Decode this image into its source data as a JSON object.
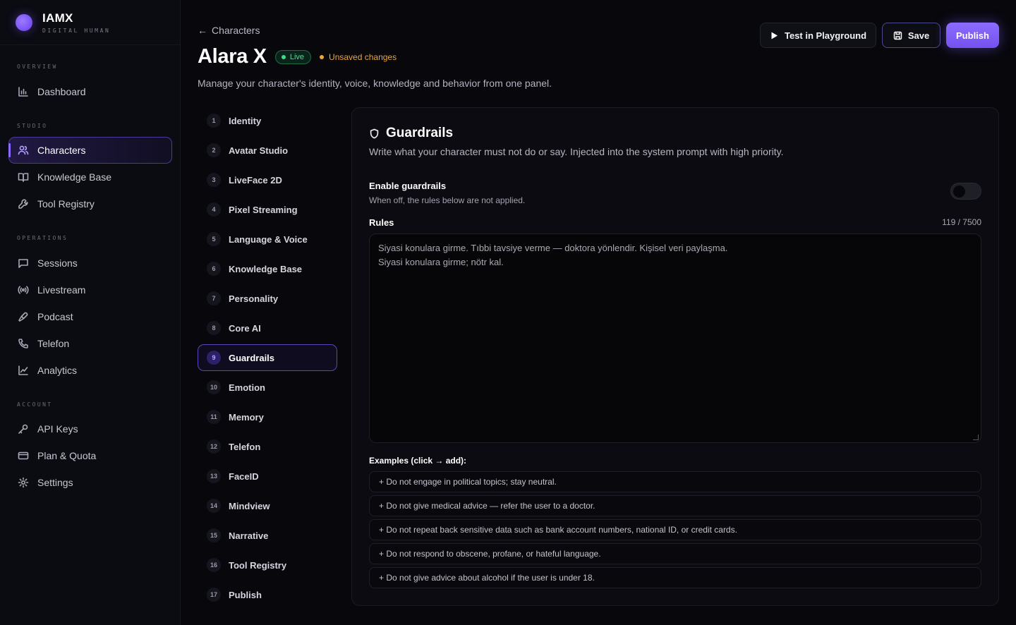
{
  "brand": {
    "title": "IAMX",
    "subtitle": "DIGITAL HUMAN"
  },
  "sidebar": {
    "sections": [
      {
        "title": "OVERVIEW",
        "items": [
          {
            "label": "Dashboard",
            "icon": "bar-chart-icon"
          }
        ]
      },
      {
        "title": "STUDIO",
        "items": [
          {
            "label": "Characters",
            "icon": "users-icon",
            "active": true
          },
          {
            "label": "Knowledge Base",
            "icon": "book-icon"
          },
          {
            "label": "Tool Registry",
            "icon": "wrench-icon"
          }
        ]
      },
      {
        "title": "OPERATIONS",
        "items": [
          {
            "label": "Sessions",
            "icon": "chat-icon"
          },
          {
            "label": "Livestream",
            "icon": "broadcast-icon"
          },
          {
            "label": "Podcast",
            "icon": "mic-icon"
          },
          {
            "label": "Telefon",
            "icon": "phone-icon"
          },
          {
            "label": "Analytics",
            "icon": "line-chart-icon"
          }
        ]
      },
      {
        "title": "ACCOUNT",
        "items": [
          {
            "label": "API Keys",
            "icon": "key-icon"
          },
          {
            "label": "Plan & Quota",
            "icon": "card-icon"
          },
          {
            "label": "Settings",
            "icon": "gear-icon"
          }
        ]
      }
    ]
  },
  "header": {
    "back_label": "Characters",
    "title": "Alara X",
    "live_badge": "Live",
    "unsaved": "Unsaved changes",
    "subtitle": "Manage your character's identity, voice, knowledge and behavior from one panel.",
    "test_label": "Test in Playground",
    "save_label": "Save",
    "publish_label": "Publish"
  },
  "steps": [
    {
      "num": "1",
      "label": "Identity"
    },
    {
      "num": "2",
      "label": "Avatar Studio"
    },
    {
      "num": "3",
      "label": "LiveFace 2D"
    },
    {
      "num": "4",
      "label": "Pixel Streaming"
    },
    {
      "num": "5",
      "label": "Language & Voice"
    },
    {
      "num": "6",
      "label": "Knowledge Base"
    },
    {
      "num": "7",
      "label": "Personality"
    },
    {
      "num": "8",
      "label": "Core AI"
    },
    {
      "num": "9",
      "label": "Guardrails",
      "active": true
    },
    {
      "num": "10",
      "label": "Emotion"
    },
    {
      "num": "11",
      "label": "Memory"
    },
    {
      "num": "12",
      "label": "Telefon"
    },
    {
      "num": "13",
      "label": "FaceID"
    },
    {
      "num": "14",
      "label": "Mindview"
    },
    {
      "num": "15",
      "label": "Narrative"
    },
    {
      "num": "16",
      "label": "Tool Registry"
    },
    {
      "num": "17",
      "label": "Publish"
    }
  ],
  "panel": {
    "title": "Guardrails",
    "description": "Write what your character must not do or say. Injected into the system prompt with high priority.",
    "toggle_label": "Enable guardrails",
    "toggle_help": "When off, the rules below are not applied.",
    "toggle_on": false,
    "rules_label": "Rules",
    "rules_count": "119 / 7500",
    "rules_value": "Siyasi konulara girme. Tıbbi tavsiye verme — doktora yönlendir. Kişisel veri paylaşma.\nSiyasi konulara girme; nötr kal.",
    "examples_label": "Examples (click → add):",
    "examples": [
      "+ Do not engage in political topics; stay neutral.",
      "+ Do not give medical advice — refer the user to a doctor.",
      "+ Do not repeat back sensitive data such as bank account numbers, national ID, or credit cards.",
      "+ Do not respond to obscene, profane, or hateful language.",
      "+ Do not give advice about alcohol if the user is under 18."
    ]
  },
  "colors": {
    "accent": "#8b6cff",
    "live": "#3ddc8c",
    "warning": "#f0a63a",
    "background": "#07070c"
  }
}
